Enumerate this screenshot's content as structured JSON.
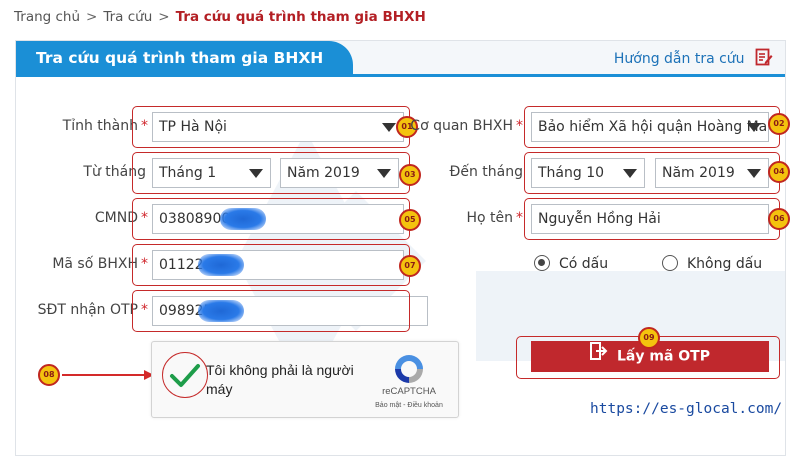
{
  "breadcrumb": {
    "home": "Trang chủ",
    "lookup": "Tra cứu",
    "current": "Tra cứu quá trình tham gia BHXH",
    "separator": ">"
  },
  "panel": {
    "title": "Tra cứu quá trình tham gia BHXH",
    "help_label": "Hướng dẫn tra cứu"
  },
  "form": {
    "province": {
      "label": "Tỉnh thành",
      "value": "TP Hà Nội",
      "badge": "01"
    },
    "agency": {
      "label": "Cơ quan BHXH",
      "value": "Bảo hiểm Xã hội quận Hoàng Mai",
      "badge": "02"
    },
    "from": {
      "label": "Từ tháng",
      "month": "Tháng 1",
      "year": "Năm 2019",
      "badge": "03"
    },
    "to": {
      "label": "Đến tháng",
      "month": "Tháng 10",
      "year": "Năm 2019",
      "badge": "04"
    },
    "id_card": {
      "label": "CMND",
      "value": "03808900",
      "badge": "05"
    },
    "full_name": {
      "label": "Họ tên",
      "value": "Nguyễn Hồng Hải",
      "badge": "06"
    },
    "insurance_no": {
      "label": "Mã số BHXH",
      "value": "01122",
      "badge": "07"
    },
    "phone": {
      "label": "SĐT nhận OTP",
      "value": "098925"
    },
    "required_mark": "*",
    "accent_option": {
      "on_label": "Có dấu",
      "off_label": "Không dấu",
      "selected": "Có dấu"
    }
  },
  "captcha": {
    "text": "Tôi không phải là người máy",
    "brand": "reCAPTCHA",
    "links": "Bảo mật - Điều khoản",
    "badge": "08",
    "checked": true
  },
  "otp_button": {
    "label": "Lấy mã OTP",
    "badge": "09"
  },
  "site_url": "https://es-glocal.com/",
  "colors": {
    "primary_blue": "#1b8fd6",
    "action_red": "#c0282d",
    "annotation_red": "#c52a2a",
    "badge_yellow": "#f4c30e",
    "check_green": "#1e9d4a"
  }
}
